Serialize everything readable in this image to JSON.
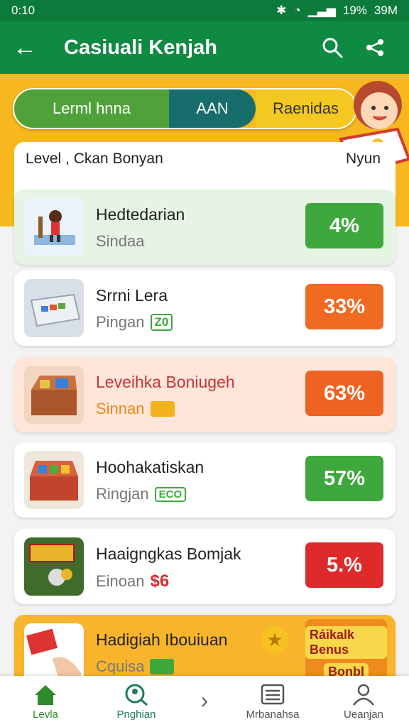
{
  "status_bar": {
    "time": "0:10",
    "battery": "19%",
    "clock_right": "39M"
  },
  "app_bar": {
    "back_label": "←",
    "title": "Casiuali Kenjah"
  },
  "tabs": [
    {
      "label": "Lerml hnna"
    },
    {
      "label": "AAN"
    },
    {
      "label": "Raenidas"
    }
  ],
  "list_header": {
    "left": "Level , Ckan Bonyan",
    "right": "Nyun"
  },
  "rows": [
    {
      "title": "Hedtedarian",
      "subtitle": "Sindaa",
      "badge": "4%",
      "badge_color": "#3ea83d",
      "bg": "#e6f4e4",
      "title_color": "#222"
    },
    {
      "title": "Srrni Lera",
      "subtitle": "Pingan",
      "tag": "Z0",
      "badge": "33%",
      "badge_color": "#f06a22",
      "bg": "#ffffff",
      "title_color": "#222"
    },
    {
      "title": "Leveihka Boniugeh",
      "subtitle": "Sinnan",
      "badge": "63%",
      "badge_color": "#ef6322",
      "bg": "#ffe6d8",
      "title_color": "#c8323a"
    },
    {
      "title": "Hoohakatiskan",
      "subtitle": "Ringjan",
      "tag": "ECO",
      "badge": "57%",
      "badge_color": "#3ea83d",
      "bg": "#ffffff",
      "title_color": "#222"
    },
    {
      "title": "Haaigngkas Bomjak",
      "subtitle": "Einoan",
      "tag": "$6",
      "badge": "5.%",
      "badge_color": "#de2a2a",
      "bg": "#ffffff",
      "title_color": "#222"
    },
    {
      "title": "Hadigiah Ibouiuan",
      "subtitle": "Cquisa",
      "badge": "Ráikalk Benus",
      "badge2": "Bonbl",
      "badge_color": "#f0a21d",
      "bg": "#f8b52c",
      "title_color": "#222"
    }
  ],
  "bottom_nav": [
    {
      "label": "Levla",
      "icon": "home-icon",
      "active": true
    },
    {
      "label": "Pnghian",
      "icon": "search-user-icon",
      "active": false
    },
    {
      "label": "",
      "icon": "chevron-right-icon",
      "active": false
    },
    {
      "label": "Mrbanahsa",
      "icon": "list-icon",
      "active": false
    },
    {
      "label": "Ueanjan",
      "icon": "user-icon",
      "active": false
    }
  ]
}
